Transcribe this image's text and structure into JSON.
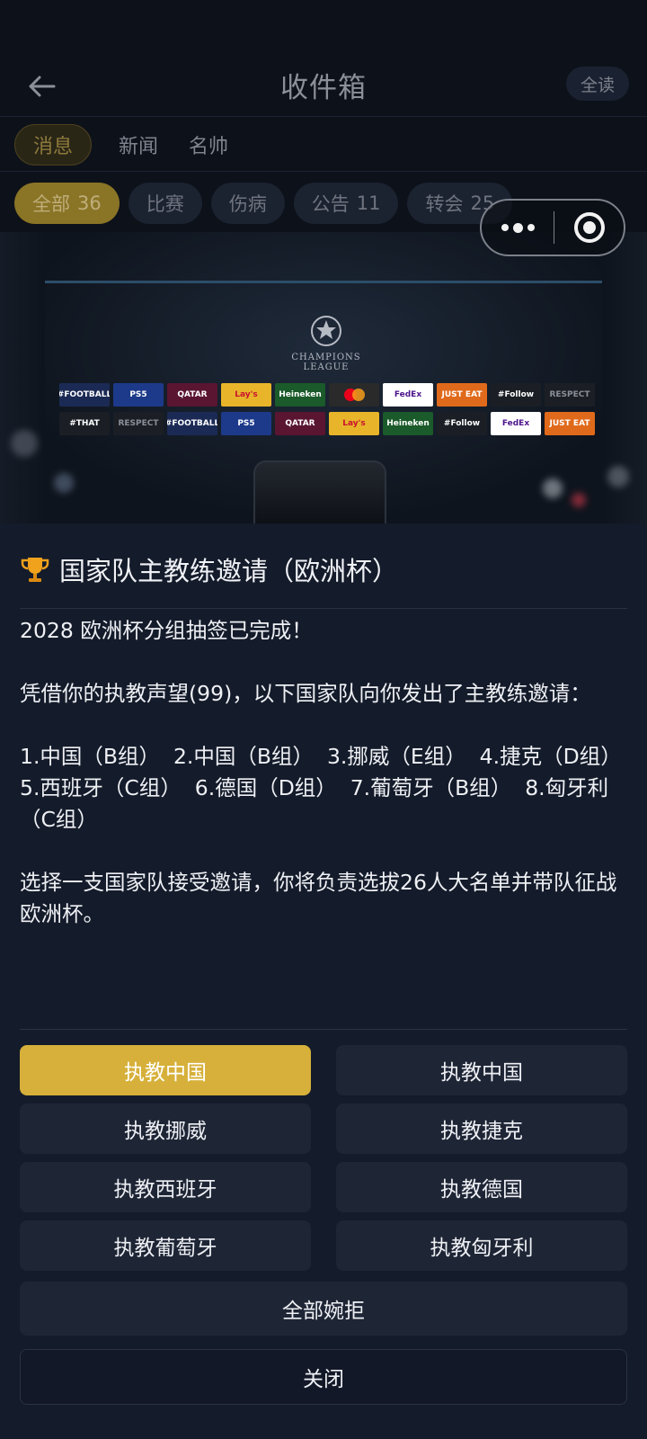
{
  "header": {
    "title": "收件箱",
    "read_all": "全读"
  },
  "tabs": [
    {
      "label": "消息",
      "active": true
    },
    {
      "label": "新闻",
      "active": false
    },
    {
      "label": "名帅",
      "active": false
    }
  ],
  "filters": [
    {
      "label": "全部",
      "count": "36",
      "active": true
    },
    {
      "label": "比赛",
      "count": "",
      "active": false
    },
    {
      "label": "伤病",
      "count": "",
      "active": false
    },
    {
      "label": "公告",
      "count": "11",
      "active": false
    },
    {
      "label": "转会",
      "count": "25",
      "active": false
    }
  ],
  "banner": {
    "logo_text_1": "CHAMPIONS",
    "logo_text_2": "LEAGUE",
    "row1": [
      "#FOOTBALL",
      "PS5",
      "QATAR",
      "Lay's",
      "Heineken",
      "",
      "FedEx",
      "JUST EAT",
      "#Follow",
      "RESPECT"
    ],
    "row2": [
      "#THAT",
      "RESPECT",
      "#FOOTBALL",
      "PS5",
      "QATAR",
      "Lay's",
      "Heineken",
      "#Follow",
      "FedEx",
      "JUST EAT"
    ]
  },
  "message": {
    "icon": "trophy-icon",
    "title": "国家队主教练邀请（欧洲杯）",
    "body": "2028 欧洲杯分组抽签已完成！\n\n凭借你的执教声望(99)，以下国家队向你发出了主教练邀请：\n\n1.中国（B组）  2.中国（B组）  3.挪威（E组）  4.捷克（D组）\n5.西班牙（C组）  6.德国（D组）  7.葡萄牙（B组）  8.匈牙利（C组）\n\n选择一支国家队接受邀请，你将负责选拔26人大名单并带队征战欧洲杯。"
  },
  "options": [
    {
      "label": "执教中国",
      "primary": true
    },
    {
      "label": "执教中国",
      "primary": false
    },
    {
      "label": "执教挪威",
      "primary": false
    },
    {
      "label": "执教捷克",
      "primary": false
    },
    {
      "label": "执教西班牙",
      "primary": false
    },
    {
      "label": "执教德国",
      "primary": false
    },
    {
      "label": "执教葡萄牙",
      "primary": false
    },
    {
      "label": "执教匈牙利",
      "primary": false
    }
  ],
  "decline_all": "全部婉拒",
  "close": "关闭",
  "colors": {
    "accent": "#d6b03a",
    "background": "#141b2a",
    "button": "#1e2535"
  }
}
